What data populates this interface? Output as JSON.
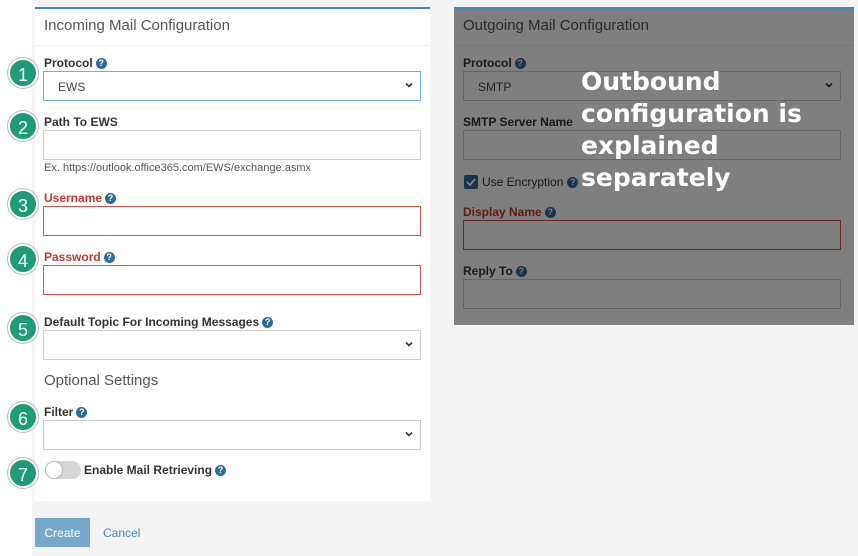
{
  "incoming": {
    "title": "Incoming Mail Configuration",
    "protocol_label": "Protocol",
    "protocol_value": "EWS",
    "path_label": "Path To EWS",
    "path_value": "",
    "path_hint": "Ex. https://outlook.office365.com/EWS/exchange.asmx",
    "username_label": "Username",
    "username_value": "",
    "password_label": "Password",
    "password_value": "",
    "topic_label": "Default Topic For Incoming Messages",
    "topic_value": "",
    "optional_title": "Optional Settings",
    "filter_label": "Filter",
    "filter_value": "",
    "retrieve_label": "Enable Mail Retrieving",
    "retrieve_enabled": false
  },
  "steps": [
    "1",
    "2",
    "3",
    "4",
    "5",
    "6",
    "7"
  ],
  "actions": {
    "create": "Create",
    "cancel": "Cancel"
  },
  "outgoing": {
    "title": "Outgoing Mail Configuration",
    "protocol_label": "Protocol",
    "protocol_value": "SMTP",
    "server_label": "SMTP Server Name",
    "encryption_label": "Use Encryption",
    "encryption_checked": true,
    "display_label": "Display Name",
    "reply_label": "Reply To"
  },
  "overlay_note": "Outbound configuration is explained separately",
  "colors": {
    "accent": "#3c8dbc",
    "step": "#1e9c78",
    "error": "#d9534f",
    "help": "#2a6d9a"
  },
  "icons": {
    "help": "question-circle-icon",
    "dropdown": "chevron-down-icon",
    "check": "check-icon"
  }
}
